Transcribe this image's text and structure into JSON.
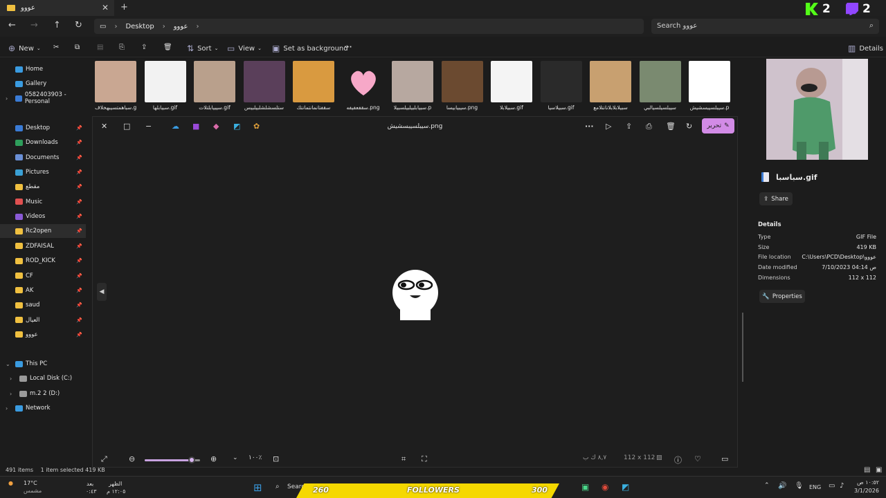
{
  "window": {
    "tab_title": "عووو",
    "tab_close": "✕",
    "new_tab": "+",
    "badges": [
      {
        "label": "2",
        "color": "#53fc18"
      },
      {
        "label": "2",
        "color": "#9146ff"
      }
    ]
  },
  "address": {
    "breadcrumbs": [
      "Desktop",
      "عووو"
    ],
    "search_placeholder": "Search عووو"
  },
  "toolbar": {
    "new_label": "New",
    "sort_label": "Sort",
    "view_label": "View",
    "set_bg_label": "Set as background",
    "more_label": "···",
    "details_label": "Details"
  },
  "sidebar": {
    "top_items": [
      {
        "label": "Home",
        "icon": "home-icon"
      },
      {
        "label": "Gallery",
        "icon": "gallery-icon"
      },
      {
        "label": "0582403903 - Personal",
        "icon": "onedrive-icon"
      }
    ],
    "pinned": [
      {
        "label": "Desktop",
        "color": "#3a7bd5"
      },
      {
        "label": "Downloads",
        "color": "#2e9e5b"
      },
      {
        "label": "Documents",
        "color": "#6a8fd5"
      },
      {
        "label": "Pictures",
        "color": "#3aa0d5"
      },
      {
        "label": "مقطع",
        "color": "#f0c040"
      },
      {
        "label": "Music",
        "color": "#e05050"
      },
      {
        "label": "Videos",
        "color": "#8a5ad5"
      },
      {
        "label": "Rc2open",
        "color": "#f0c040"
      },
      {
        "label": "ZDFAISAL",
        "color": "#f0c040"
      },
      {
        "label": "ROD_KICK",
        "color": "#f0c040"
      },
      {
        "label": "CF",
        "color": "#f0c040"
      },
      {
        "label": "AK",
        "color": "#f0c040"
      },
      {
        "label": "saud",
        "color": "#f0c040"
      },
      {
        "label": "العيال",
        "color": "#f0c040"
      },
      {
        "label": "عووو",
        "color": "#f0c040"
      }
    ],
    "drives": [
      {
        "label": "This PC"
      },
      {
        "label": "Local Disk (C:)"
      },
      {
        "label": "m.2 2 (D:)"
      },
      {
        "label": "Network"
      }
    ]
  },
  "thumbs": [
    {
      "caption": "سباهمتسيبهخلاف.gif",
      "color": "#c9a792"
    },
    {
      "caption": "سبيابلها.gif",
      "color": "#f2f2f2"
    },
    {
      "caption": "سيبيابلتلات.gif",
      "color": "#b9a08c"
    },
    {
      "caption": "ستلسشلشلبيلبيس",
      "color": "#5a3f5a"
    },
    {
      "caption": "سقفتانمانتمانتك",
      "color": "#d99a40"
    },
    {
      "caption": "سقفعفيفه.png",
      "color": "#1c1c1c"
    },
    {
      "caption": "سبيابلبيلبيلسبيلا.p",
      "color": "#b7a8a0"
    },
    {
      "caption": "سيبيابيسا.png",
      "color": "#6b4a30"
    },
    {
      "caption": "سبيلابلا.gif",
      "color": "#f4f4f4"
    },
    {
      "caption": "سبيلاسيا.gif",
      "color": "#2a2a2a"
    },
    {
      "caption": "سبيلابلابلانانتلامع",
      "color": "#c8a070"
    },
    {
      "caption": "سيبلسيلسيالبي",
      "color": "#7a8a70"
    },
    {
      "caption": "سيبلسيبسشيش.p",
      "color": "#ffffff"
    }
  ],
  "viewer": {
    "title": "سيبلسيبسشيش.png",
    "edit_label": "تحرير",
    "zoom_label": "١٠٠٪",
    "zoom_fraction": 0.85,
    "size_label": "٨,٧ ك ب",
    "dims_label": "112 x 112"
  },
  "details": {
    "file_name": "سباسبا.gif",
    "share_label": "Share",
    "heading": "Details",
    "rows": [
      {
        "key": "Type",
        "value": "GIF File"
      },
      {
        "key": "Size",
        "value": "419 KB"
      },
      {
        "key": "File location",
        "value": "C:\\Users\\PCD\\Desktop\\عووو"
      },
      {
        "key": "Date modified",
        "value": "7/10/2023 04:14 ص"
      },
      {
        "key": "Dimensions",
        "value": "112 x 112"
      }
    ],
    "properties_label": "Properties"
  },
  "status": {
    "items": "491 items",
    "selected": "1 item selected  419 KB"
  },
  "taskbar": {
    "weather_temp": "17°C",
    "weather_desc": "مشمس",
    "after_label": "بعد",
    "after_time": "٠:٤٣",
    "prayer_label": "الظهر",
    "prayer_time": "١٢:٠٥ م",
    "search_label": "Search",
    "lang": "ENG",
    "clock_time": "١٠:٥٢ ص",
    "clock_date": "3/1/2026",
    "followers_left": "260",
    "followers_label": "FOLLOWERS",
    "followers_right": "300"
  }
}
